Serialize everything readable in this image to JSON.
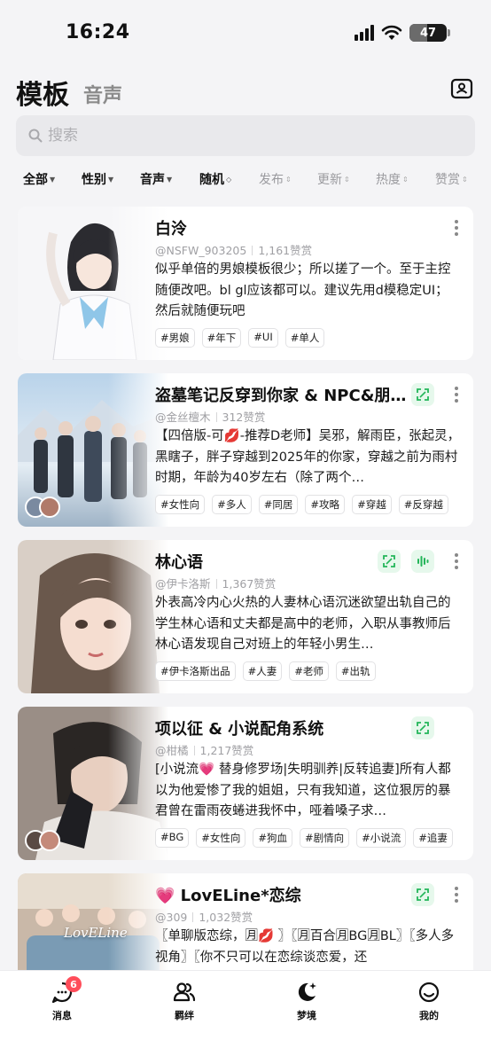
{
  "status": {
    "time": "16:24",
    "battery": "47",
    "battery_level": 0.47
  },
  "header": {
    "tab_active": "模板",
    "tab_inactive": "音声"
  },
  "search": {
    "placeholder": "搜索"
  },
  "filters": [
    {
      "label": "全部",
      "active": true
    },
    {
      "label": "性别",
      "active": true
    },
    {
      "label": "音声",
      "active": true
    },
    {
      "label": "随机",
      "active": true
    },
    {
      "label": "发布",
      "active": false
    },
    {
      "label": "更新",
      "active": false
    },
    {
      "label": "热度",
      "active": false
    },
    {
      "label": "赞赏",
      "active": false
    }
  ],
  "cards": [
    {
      "title": "白泠",
      "author": "@NSFW_903205",
      "likes": "1,161赞赏",
      "desc": "似乎单倍的男娘模板很少；所以搓了一个。至于主控随便改吧。bl gl应该都可以。建议先用d模稳定UI；然后就随便玩吧",
      "tags": [
        "#男娘",
        "#年下",
        "#UI",
        "#单人"
      ]
    },
    {
      "title": "盗墓笔记反穿到你家 & NPC&朋…",
      "author": "@金丝檀木",
      "likes": "312赞赏",
      "desc": "【四倍版-可💋-推荐D老师】吴邪，解雨臣，张起灵，黑瞎子，胖子穿越到2025年的你家，穿越之前为雨村时期，年龄为40岁左右（除了两个…",
      "tags": [
        "#女性向",
        "#多人",
        "#同居",
        "#攻略",
        "#穿越",
        "#反穿越"
      ]
    },
    {
      "title": "林心语",
      "author": "@伊卡洛斯",
      "likes": "1,367赞赏",
      "desc": "外表高冷内心火热的人妻林心语沉迷欲望出轨自己的学生林心语和丈夫都是高中的老师，入职从事教师后林心语发现自己对班上的年轻小男生…",
      "tags": [
        "#伊卡洛斯出品",
        "#人妻",
        "#老师",
        "#出轨"
      ]
    },
    {
      "title": "项以征 & 小说配角系统",
      "author": "@柑橘",
      "likes": "1,217赞赏",
      "desc": "[小说流💗 替身修罗场|失明驯养|反转追妻]所有人都以为他爱惨了我的姐姐，只有我知道，这位狠厉的暴君曾在雷雨夜蜷进我怀中，哑着嗓子求…",
      "tags": [
        "#BG",
        "#女性向",
        "#狗血",
        "#剧情向",
        "#小说流",
        "#追妻"
      ]
    },
    {
      "title": "💗 LovELine*恋综",
      "author": "@309",
      "likes": "1,032赞赏",
      "desc": "〖单聊版恋综，🈷💋 〗〖🈷百合🈷BG🈷BL〗〖多人多视角〗〖你不只可以在恋综谈恋爱，还",
      "tags": [],
      "img_text": "LovELine"
    }
  ],
  "nav": [
    {
      "label": "消息",
      "badge": "6"
    },
    {
      "label": "羁绊"
    },
    {
      "label": "梦境"
    },
    {
      "label": "我的"
    }
  ]
}
